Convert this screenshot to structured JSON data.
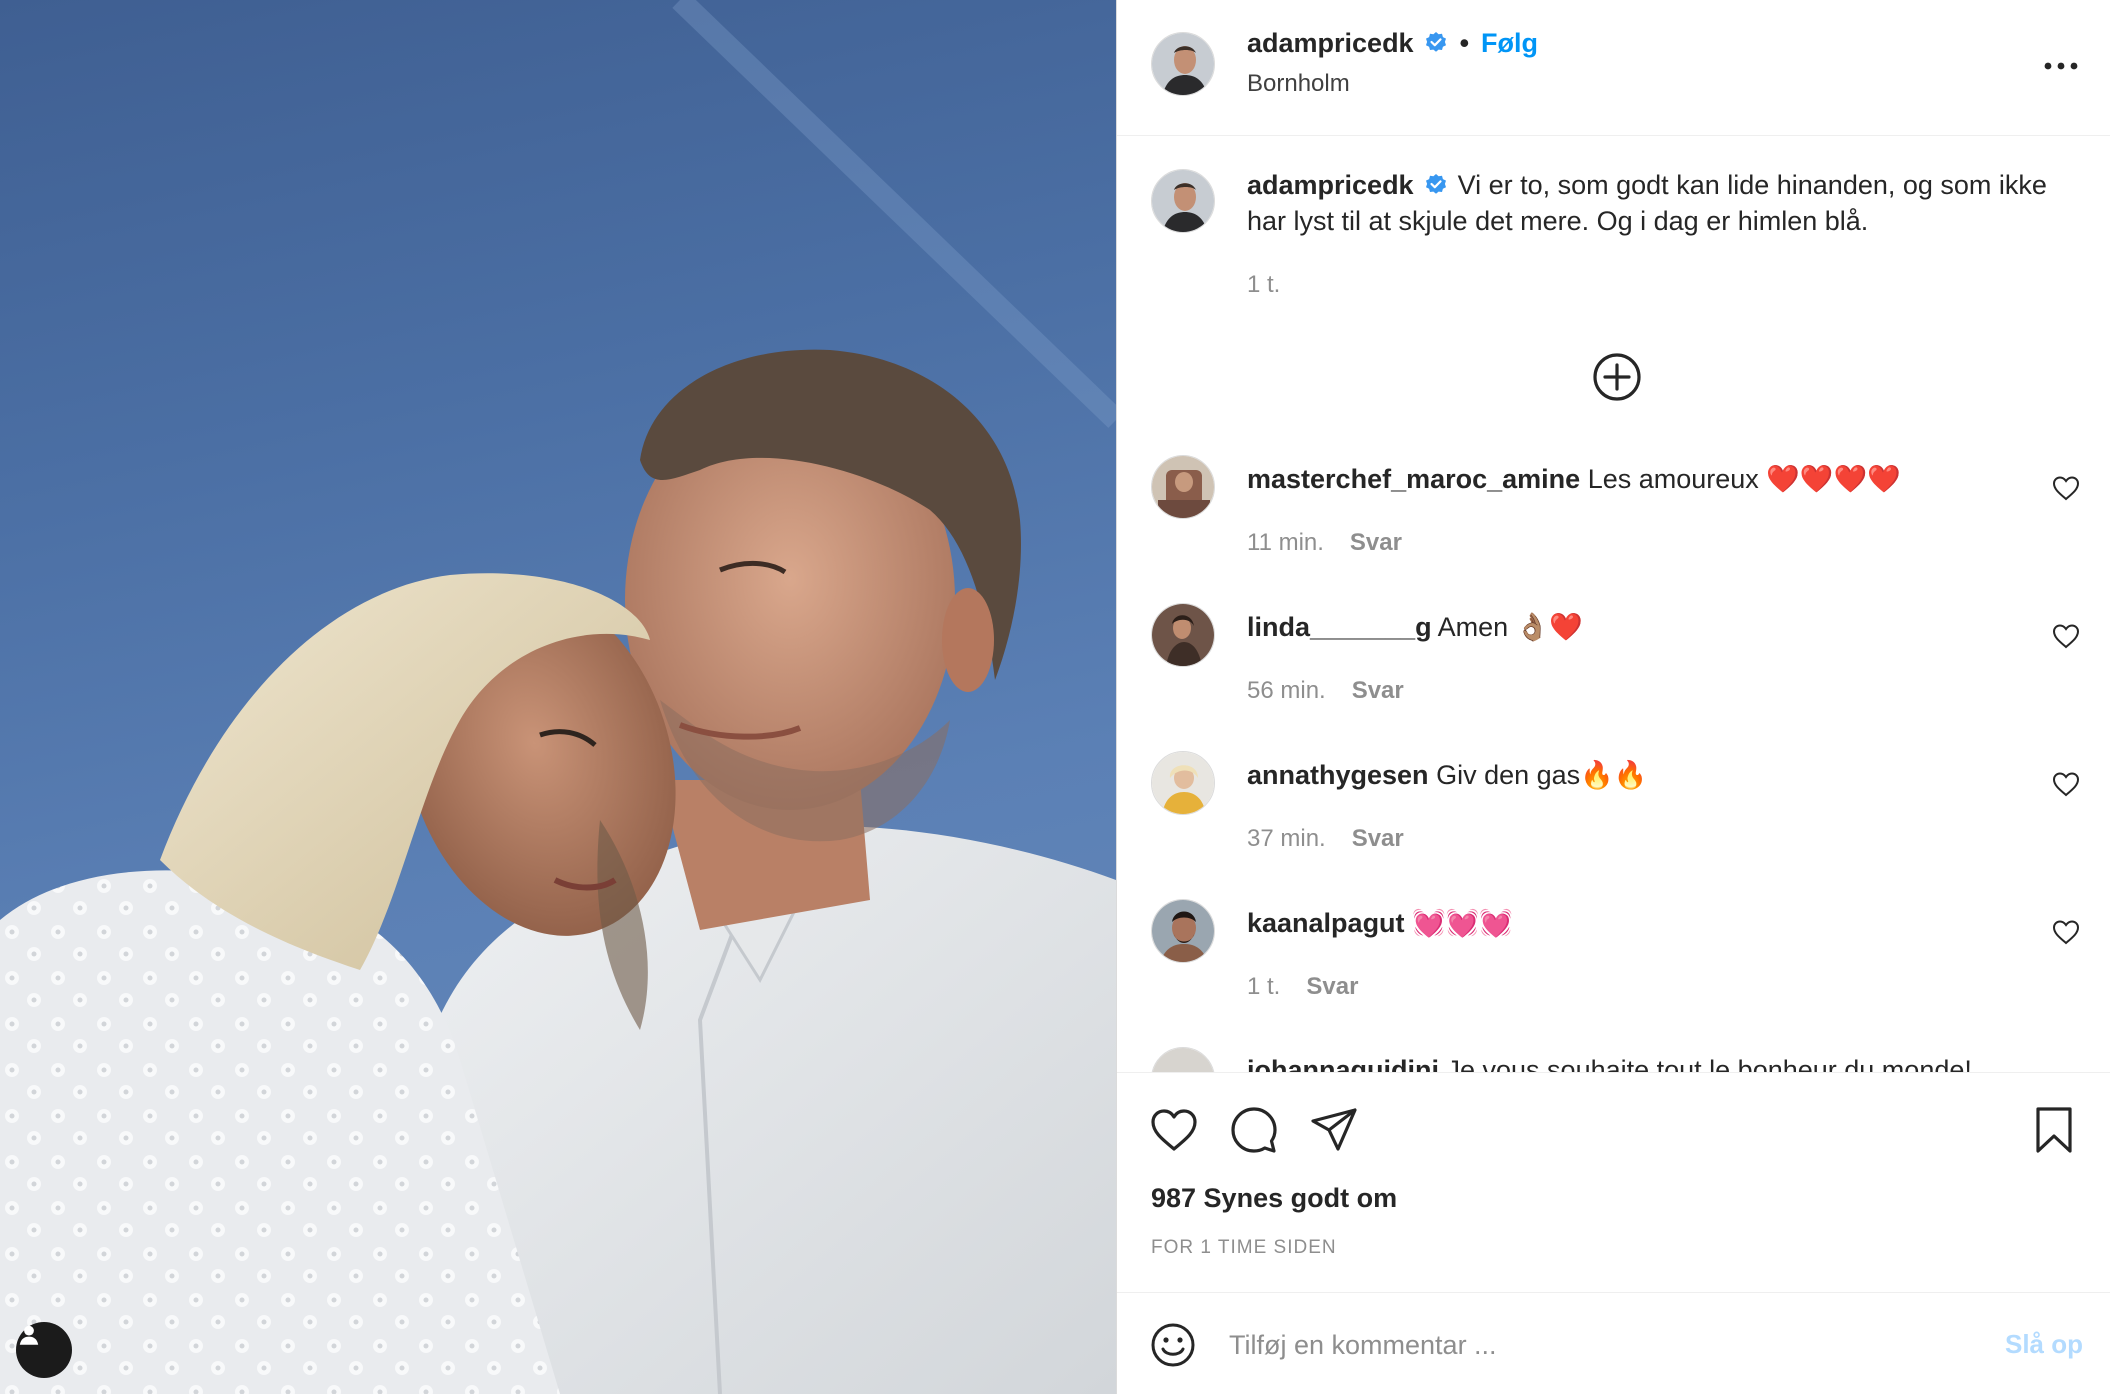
{
  "post": {
    "username": "adampricedk",
    "separator": "•",
    "follow_label": "Følg",
    "location": "Bornholm",
    "caption": "Vi er to, som godt kan lide hinanden, og som ikke har lyst til at skjule det mere. Og i dag er himlen blå.",
    "caption_time": "1 t."
  },
  "comments": [
    {
      "username": "masterchef_maroc_amine",
      "text": "Les amoureux ❤️❤️❤️❤️",
      "time": "11 min.",
      "reply": "Svar"
    },
    {
      "username": "linda_______g",
      "text": "Amen 👌🏽❤️",
      "time": "56 min.",
      "reply": "Svar"
    },
    {
      "username": "annathygesen",
      "text": "Giv den gas🔥🔥",
      "time": "37 min.",
      "reply": "Svar"
    },
    {
      "username": "kaanalpagut",
      "text": "💓💓💓",
      "time": "1 t.",
      "reply": "Svar"
    },
    {
      "username": "johannaguidini",
      "text": "Je vous souhaite tout le bonheur du monde!",
      "time": "",
      "reply": ""
    }
  ],
  "actions": {
    "likes": "987 Synes godt om",
    "time_ago": "FOR 1 TIME SIDEN"
  },
  "composer": {
    "placeholder": "Tilføj en kommentar ...",
    "post_label": "Slå op"
  },
  "colors": {
    "accent": "#0095f6",
    "verified": "#3897f0",
    "post_disabled": "#b3dbff",
    "muted": "#8e8e8e"
  },
  "icons": [
    "more-icon",
    "verified-icon",
    "plus-circle-icon",
    "heart-icon",
    "comment-icon",
    "share-icon",
    "bookmark-icon",
    "emoji-icon",
    "user-tag-icon"
  ]
}
